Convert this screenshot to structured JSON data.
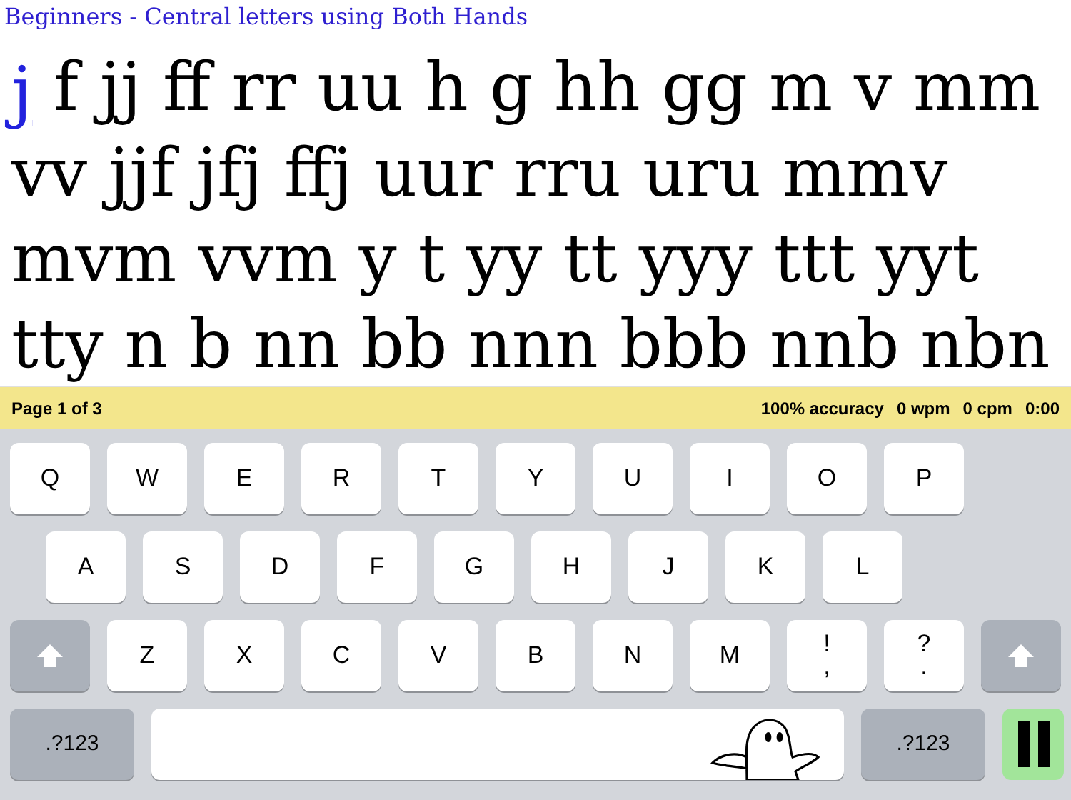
{
  "lesson_title": "Beginners - Central letters using Both Hands",
  "practice": {
    "current": "j",
    "lines": [
      " f jj ff rr uu h g hh gg m v mm",
      "vv jjf jfj ffj uur rru uru mmv",
      "mvm vvm y t yy tt yyy ttt yyt",
      "tty n b nn bb nnn bbb nnb nbn"
    ]
  },
  "status_bar": {
    "page": "Page 1 of 3",
    "stats": [
      "100% accuracy",
      "0 wpm",
      "0 cpm",
      "0:00"
    ]
  },
  "keyboard": {
    "rows": [
      {
        "keys": [
          {
            "kind": "letter",
            "label": "Q"
          },
          {
            "kind": "letter",
            "label": "W"
          },
          {
            "kind": "letter",
            "label": "E"
          },
          {
            "kind": "letter",
            "label": "R"
          },
          {
            "kind": "letter",
            "label": "T"
          },
          {
            "kind": "letter",
            "label": "Y"
          },
          {
            "kind": "letter",
            "label": "U"
          },
          {
            "kind": "letter",
            "label": "I"
          },
          {
            "kind": "letter",
            "label": "O"
          },
          {
            "kind": "letter",
            "label": "P"
          }
        ]
      },
      {
        "keys": [
          {
            "kind": "letter",
            "label": "A"
          },
          {
            "kind": "letter",
            "label": "S"
          },
          {
            "kind": "letter",
            "label": "D"
          },
          {
            "kind": "letter",
            "label": "F"
          },
          {
            "kind": "letter",
            "label": "G"
          },
          {
            "kind": "letter",
            "label": "H"
          },
          {
            "kind": "letter",
            "label": "J"
          },
          {
            "kind": "letter",
            "label": "K"
          },
          {
            "kind": "letter",
            "label": "L"
          }
        ]
      },
      {
        "keys": [
          {
            "kind": "shift"
          },
          {
            "kind": "letter",
            "label": "Z"
          },
          {
            "kind": "letter",
            "label": "X"
          },
          {
            "kind": "letter",
            "label": "C"
          },
          {
            "kind": "letter",
            "label": "V"
          },
          {
            "kind": "letter",
            "label": "B"
          },
          {
            "kind": "letter",
            "label": "N"
          },
          {
            "kind": "letter",
            "label": "M"
          },
          {
            "kind": "dual",
            "top": "!",
            "bottom": ","
          },
          {
            "kind": "dual",
            "top": "?",
            "bottom": "."
          },
          {
            "kind": "shift"
          }
        ]
      },
      {
        "keys": [
          {
            "kind": "symbols",
            "label": ".?123"
          },
          {
            "kind": "space"
          },
          {
            "kind": "symbols",
            "label": ".?123"
          },
          {
            "kind": "pause"
          }
        ]
      }
    ]
  }
}
